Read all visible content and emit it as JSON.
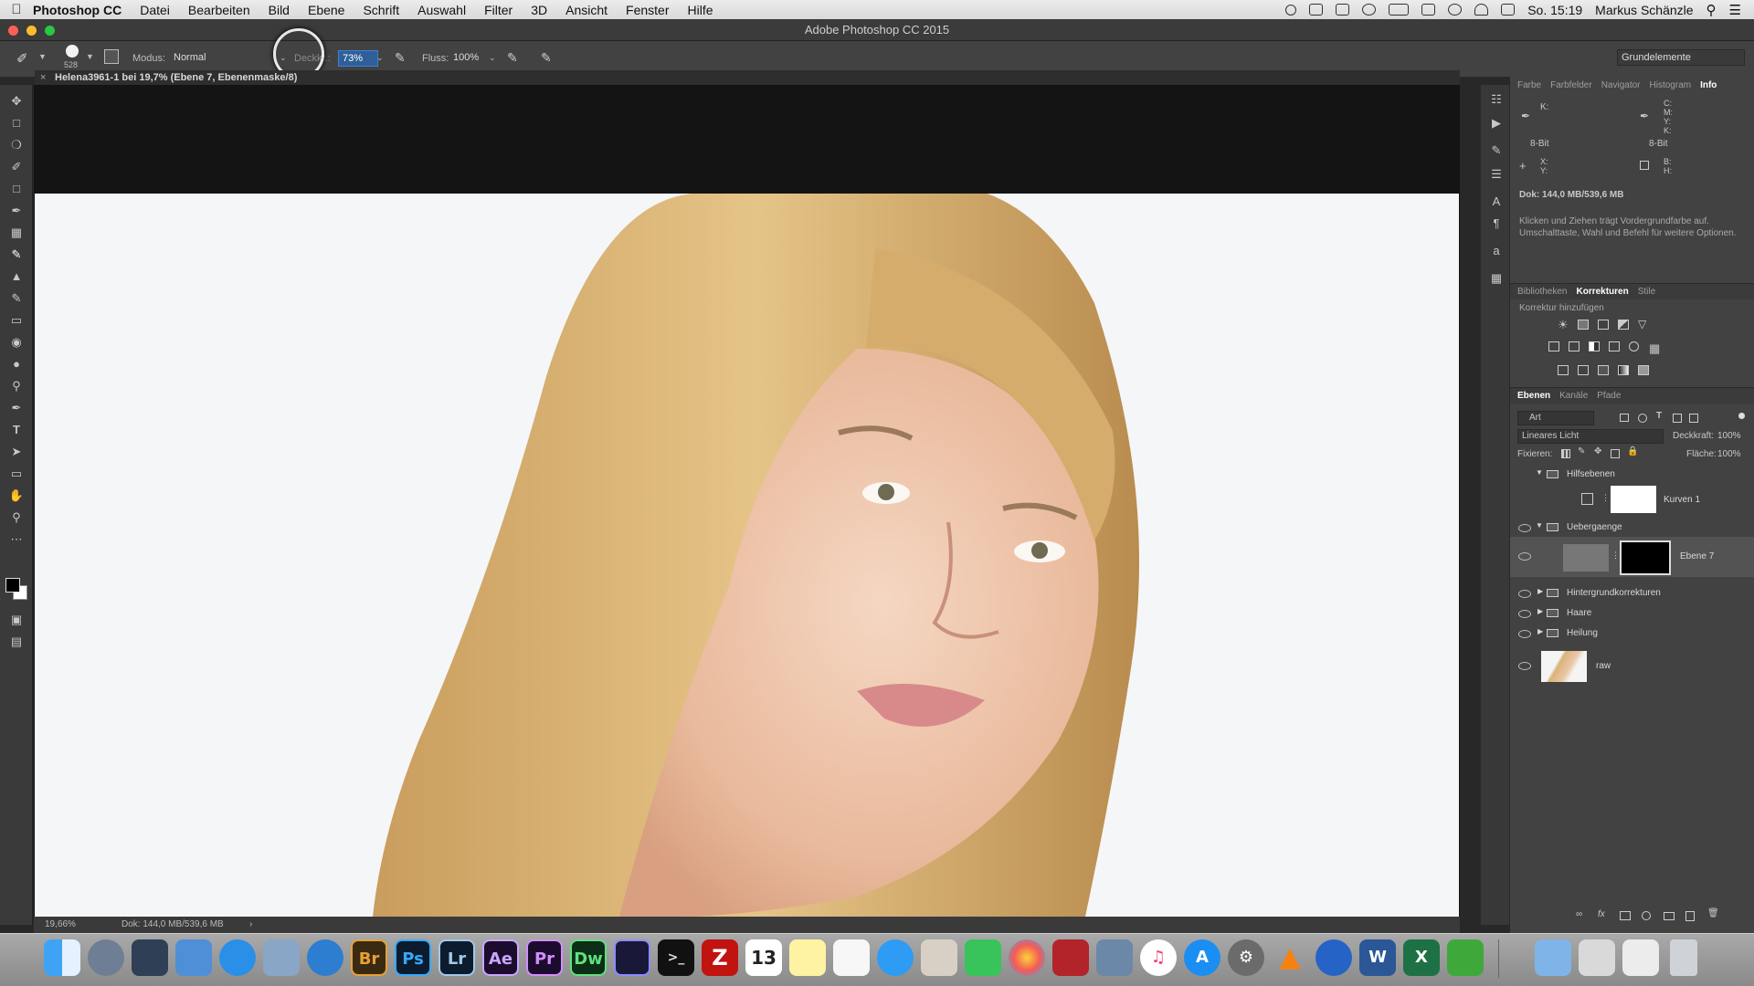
{
  "menubar": {
    "app_name": "Photoshop CC",
    "menus": [
      "Datei",
      "Bearbeiten",
      "Bild",
      "Ebene",
      "Schrift",
      "Auswahl",
      "Filter",
      "3D",
      "Ansicht",
      "Fenster",
      "Hilfe"
    ],
    "clock": "So. 15:19",
    "user": "Markus Schänzle"
  },
  "window": {
    "title": "Adobe Photoshop CC 2015"
  },
  "options_bar": {
    "brush_size": "528",
    "mode_label": "Modus:",
    "mode_value": "Normal",
    "opacity_label": "Deckkr.:",
    "opacity_value": "73%",
    "flow_label": "Fluss:",
    "flow_value": "100%",
    "workspace": "Grundelemente"
  },
  "document": {
    "tab_title": "Helena3961-1 bei 19,7% (Ebene 7, Ebenenmaske/8)",
    "zoom": "19,66%",
    "doc_size": "Dok: 144,0 MB/539,6 MB"
  },
  "info_panel": {
    "tabs": [
      "Farbe",
      "Farbfelder",
      "Navigator",
      "Histogram",
      "Info"
    ],
    "active_tab": "Info",
    "k_label": "K:",
    "cmyk_labels": [
      "C:",
      "M:",
      "Y:",
      "K:"
    ],
    "bit_left": "8-Bit",
    "bit_right": "8-Bit",
    "xy_labels": [
      "X:",
      "Y:"
    ],
    "bh_labels": [
      "B:",
      "H:"
    ],
    "doc_line": "Dok: 144,0 MB/539,6 MB",
    "hint": "Klicken und Ziehen trägt Vordergrundfarbe auf. Umschalttaste, Wahl und Befehl für weitere Optionen."
  },
  "adjustments_panel": {
    "tabs": [
      "Bibliotheken",
      "Korrekturen",
      "Stile"
    ],
    "active_tab": "Korrekturen",
    "subtitle": "Korrektur hinzufügen"
  },
  "layers_panel": {
    "tabs": [
      "Ebenen",
      "Kanäle",
      "Pfade"
    ],
    "active_tab": "Ebenen",
    "filter_value": "Art",
    "blend_mode": "Lineares Licht",
    "opacity_label": "Deckkraft:",
    "opacity_value": "100%",
    "lock_label": "Fixieren:",
    "fill_label": "Fläche:",
    "fill_value": "100%",
    "layers": [
      {
        "name": "Hilfsebenen",
        "kind": "group-open",
        "visible": false
      },
      {
        "name": "Kurven 1",
        "kind": "adjustment",
        "visible": false
      },
      {
        "name": "Uebergaenge",
        "kind": "group-open",
        "visible": true
      },
      {
        "name": "Ebene 7",
        "kind": "pixel-mask",
        "visible": true,
        "selected": true
      },
      {
        "name": "Hintergrundkorrekturen",
        "kind": "group",
        "visible": true
      },
      {
        "name": "Haare",
        "kind": "group",
        "visible": true
      },
      {
        "name": "Heilung",
        "kind": "group",
        "visible": true
      },
      {
        "name": "raw",
        "kind": "photo",
        "visible": true
      }
    ]
  },
  "dock": {
    "apps": [
      "Finder",
      "Launchpad",
      "Mission Control",
      "Folder",
      "Safari",
      "Preview",
      "1Password",
      "Br",
      "Ps",
      "Lr",
      "Ae",
      "Pr",
      "Dw",
      "Media Encoder",
      "Terminal",
      "FileZilla",
      "Kalender",
      "Notizen",
      "Erinnerungen",
      "Nachrichten",
      "Fotos",
      "FaceTime",
      "Photos",
      "Photo Booth",
      "Xcode",
      "iTunes",
      "App Store",
      "Systemeinstellungen",
      "VLC",
      "Chrome",
      "Word",
      "Excel",
      "Evernote",
      "Downloads",
      "Brushes",
      "Dokumente",
      "Papierkorb"
    ],
    "labels": {
      "br": "Br",
      "ps": "Ps",
      "lr": "Lr",
      "ae": "Ae",
      "pr": "Pr",
      "dw": "Dw",
      "calendar_day": "13",
      "word": "W",
      "excel": "X"
    }
  },
  "colors": {
    "accent": "#3b7fd6",
    "panel_bg": "#424242",
    "canvas_bg": "#141414"
  }
}
